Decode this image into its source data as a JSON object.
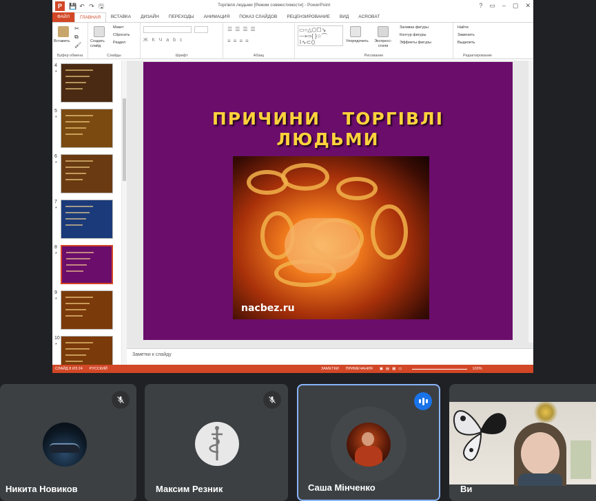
{
  "ppt": {
    "app_letter": "P",
    "window_title": "Торгівля людьми [Режим совместимости] - PowerPoint",
    "quick_access": [
      "💾",
      "↶",
      "↷",
      "🖫"
    ],
    "window_controls": [
      "?",
      "▭",
      "–",
      "▢",
      "✕"
    ],
    "tabs": [
      {
        "label": "ФАЙЛ",
        "state": "file"
      },
      {
        "label": "ГЛАВНАЯ",
        "state": "active"
      },
      {
        "label": "ВСТАВКА",
        "state": ""
      },
      {
        "label": "ДИЗАЙН",
        "state": ""
      },
      {
        "label": "ПЕРЕХОДЫ",
        "state": ""
      },
      {
        "label": "АНИМАЦИЯ",
        "state": ""
      },
      {
        "label": "ПОКАЗ СЛАЙДОВ",
        "state": ""
      },
      {
        "label": "РЕЦЕНЗИРОВАНИЕ",
        "state": ""
      },
      {
        "label": "ВИД",
        "state": ""
      },
      {
        "label": "ACROBAT",
        "state": ""
      }
    ],
    "ribbon": {
      "clipboard": {
        "label": "Буфер обмена",
        "paste": "Вставить"
      },
      "slides": {
        "label": "Слайды",
        "new_slide": "Создать слайд",
        "layout": "Макет",
        "reset": "Сбросить",
        "section": "Раздел"
      },
      "font": {
        "label": "Шрифт"
      },
      "paragraph": {
        "label": "Абзац"
      },
      "drawing": {
        "label": "Рисование",
        "arrange": "Упорядочить",
        "quick_styles": "Экспресс-стили",
        "fill": "Заливка фигуры",
        "outline": "Контур фигуры",
        "effects": "Эффекты фигуры"
      },
      "editing": {
        "label": "Редактирование",
        "find": "Найти",
        "replace": "Заменить",
        "select": "Выделить"
      }
    },
    "thumbnails": [
      {
        "num": "4",
        "star": "*",
        "bg": "#4a2a12"
      },
      {
        "num": "5",
        "star": "*",
        "bg": "#7a4a10"
      },
      {
        "num": "6",
        "star": "*",
        "bg": "#6a3b12"
      },
      {
        "num": "7",
        "star": "*",
        "bg": "#1b3a7a"
      },
      {
        "num": "8",
        "star": "*",
        "bg": "#6b0d6b",
        "selected": true
      },
      {
        "num": "9",
        "star": "*",
        "bg": "#7a3a0a"
      },
      {
        "num": "10",
        "star": "*",
        "bg": "#7a3a0a"
      }
    ],
    "slide": {
      "title": "ПРИЧИНИ   ТОРГІВЛІ\nЛЮДЬМИ",
      "watermark": "nacbez.ru",
      "background": "#6b0d6b",
      "title_color": "#ffd23c"
    },
    "notes_placeholder": "Заметки к слайду",
    "status": {
      "slide": "СЛАЙД 8 ИЗ 24",
      "language": "РУССКИЙ",
      "notes": "ЗАМЕТКИ",
      "comments": "ПРИМЕЧАНИЯ",
      "zoom": "103%"
    },
    "accent": "#d24726"
  },
  "participants": [
    {
      "name": "Никита Новиков",
      "mic": "muted"
    },
    {
      "name": "Максим Резник",
      "mic": "muted"
    },
    {
      "name": "Саша Мінченко",
      "mic": "speaking"
    },
    {
      "name": "Ви",
      "mic": "none"
    }
  ],
  "meet_accent": "#8ab4f8"
}
